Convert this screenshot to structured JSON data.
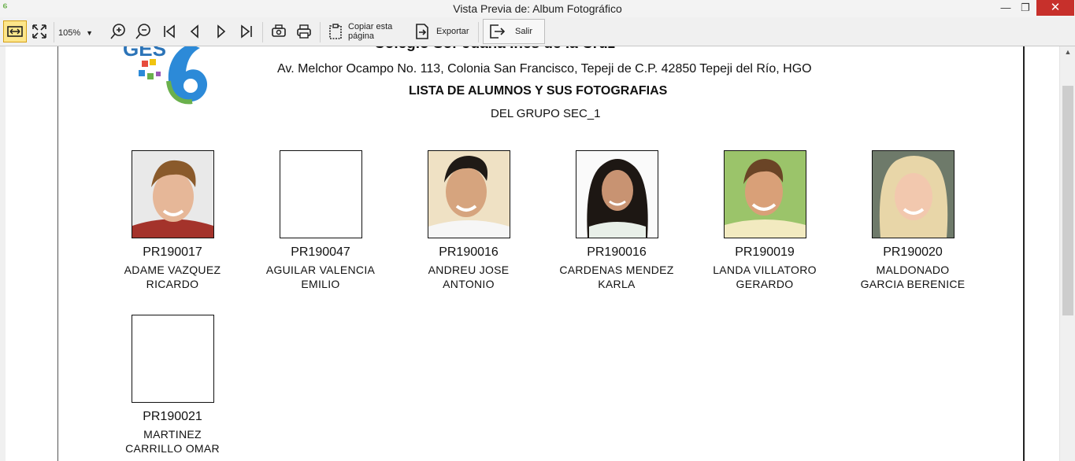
{
  "window": {
    "title": "Vista Previa de: Album Fotográfico",
    "minimize": "—",
    "maximize": "❐",
    "close": "✕"
  },
  "toolbar": {
    "zoom": "105%",
    "copy_label_line1": "Copiar esta",
    "copy_label_line2": "página",
    "export_label": "Exportar",
    "exit_label": "Salir"
  },
  "report": {
    "school_name": "Colegio Sor Juana Inés de la Cruz",
    "address": "Av. Melchor Ocampo No. 113, Colonia San Francisco, Tepeji de C.P. 42850 Tepeji del Río, HGO",
    "title": "LISTA DE ALUMNOS Y SUS FOTOGRAFIAS",
    "group": "DEL GRUPO SEC_1",
    "logo_text": "GES"
  },
  "students": [
    {
      "code": "PR190017",
      "name_line1": "ADAME VAZQUEZ",
      "name_line2": "RICARDO",
      "photo": "boy-brown-hair"
    },
    {
      "code": "PR190047",
      "name_line1": "AGUILAR VALENCIA",
      "name_line2": "EMILIO",
      "photo": "none"
    },
    {
      "code": "PR190016",
      "name_line1": "ANDREU  JOSE",
      "name_line2": "ANTONIO",
      "photo": "teen-boy"
    },
    {
      "code": "PR190016",
      "name_line1": "CARDENAS MENDEZ",
      "name_line2": "KARLA",
      "photo": "girl-dark-hair"
    },
    {
      "code": "PR190019",
      "name_line1": "LANDA VILLATORO",
      "name_line2": "GERARDO",
      "photo": "boy-outdoor"
    },
    {
      "code": "PR190020",
      "name_line1": "MALDONADO",
      "name_line2": "GARCIA BERENICE",
      "photo": "girl-blonde"
    },
    {
      "code": "PR190021",
      "name_line1": "MARTINEZ",
      "name_line2": "CARRILLO OMAR",
      "photo": "none"
    }
  ],
  "colors": {
    "close_button": "#c7302b",
    "active_tool": "#fde68a",
    "logo_blue": "#2c8ad8",
    "logo_green": "#6ab04c"
  }
}
